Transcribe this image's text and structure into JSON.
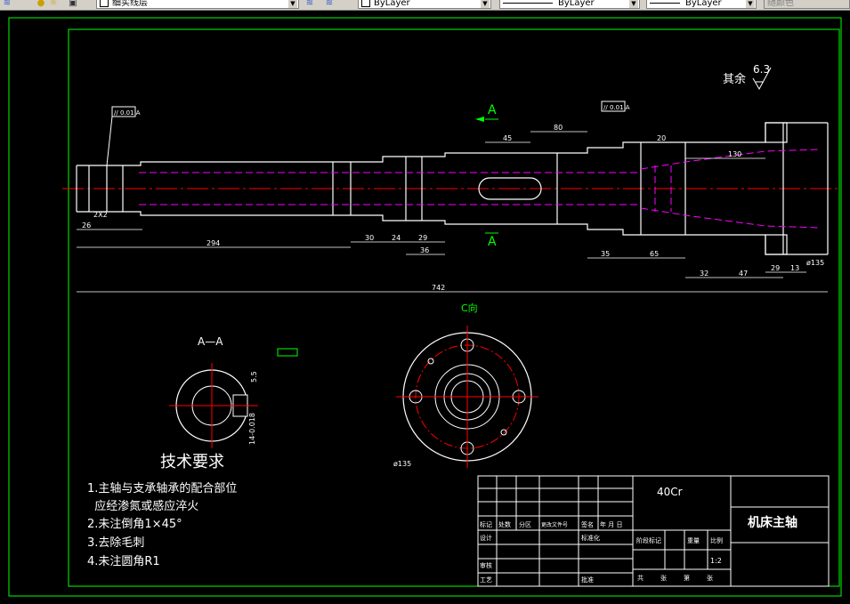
{
  "toolbar": {
    "layer_name": "细实线层",
    "color_value": "ByLayer",
    "linetype_value": "ByLayer",
    "lineweight_value": "ByLayer",
    "plotstyle_value": "随颜色"
  },
  "drawing": {
    "roughness_prefix": "其余",
    "roughness_value": "6.3",
    "section_mark": "A",
    "section_title": "A—A",
    "view_title": "C向",
    "tolerance_frame_1": "// 0.01 A",
    "tolerance_frame_2": "// 0.01 A",
    "dims": {
      "d742": "742",
      "d294": "294",
      "d45": "45",
      "d80": "80",
      "d20": "20",
      "d130": "130",
      "d35": "35",
      "d65": "65",
      "d32": "32",
      "d47": "47",
      "d13": "13",
      "d29": "29",
      "d26": "26",
      "d24": "24",
      "d30": "30",
      "d36": "36",
      "d29b": "29",
      "d135": "ø135",
      "d135b": "ø135",
      "chamfer": "2X2"
    },
    "section_dims": {
      "key_width": "14-0.018",
      "key_depth": "5.5"
    }
  },
  "tech_req": {
    "title": "技术要求",
    "items": [
      "1.主轴与支承轴承的配合部位",
      "  应经渗氮或感应淬火",
      "2.未注倒角1×45°",
      "3.去除毛刺",
      "4.未注圆角R1"
    ]
  },
  "title_block": {
    "material": "40Cr",
    "part_name": "机床主轴",
    "scale": "1:2",
    "headers": [
      "标记",
      "处数",
      "分区",
      "更改文件号",
      "签名",
      "年 月 日"
    ],
    "rows": [
      "设计",
      "审核",
      "工艺"
    ],
    "right_labels": [
      "标准化",
      "批准",
      "阶段标记",
      "重量",
      "比例"
    ],
    "footer": [
      "共",
      "张",
      "第",
      "张"
    ]
  }
}
